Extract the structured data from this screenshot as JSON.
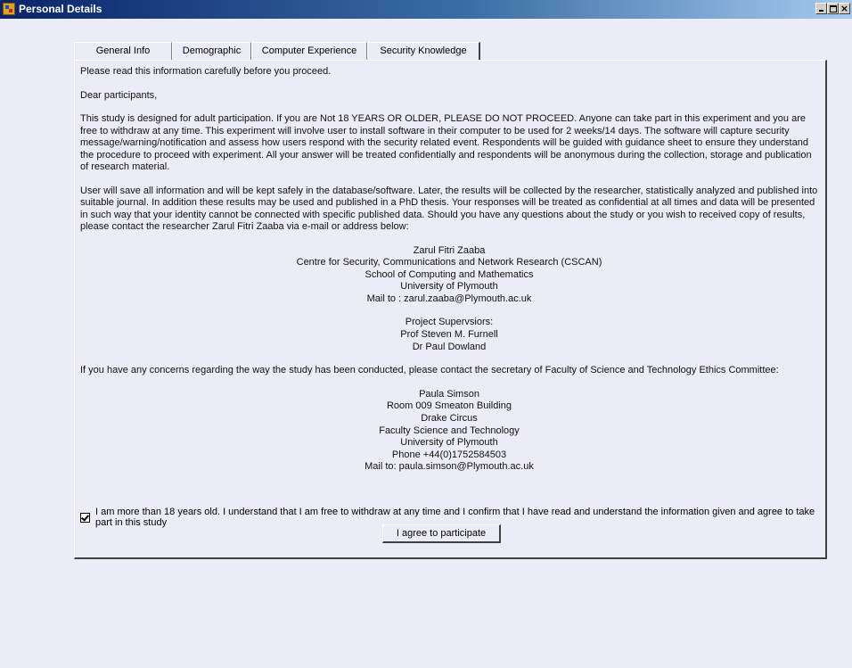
{
  "window": {
    "title": "Personal Details",
    "controls": {
      "minimize": "_",
      "maximize": "□",
      "close": "×"
    }
  },
  "tabs": [
    {
      "label": "General Info"
    },
    {
      "label": "Demographic"
    },
    {
      "label": "Computer Experience"
    },
    {
      "label": "Security Knowledge"
    }
  ],
  "content": {
    "intro": "Please read this information carefully before you proceed.",
    "greeting": "Dear participants,",
    "para1": "This study is designed for adult participation. If you are Not 18 YEARS OR OLDER, PLEASE DO NOT PROCEED. Anyone can take part in this experiment and you are free to withdraw at any time.  This experiment will involve user to install software in their computer to be used for 2 weeks/14 days.  The software will capture security message/warning/notification and assess how users respond with the security related event.  Respondents will be guided with guidance sheet to ensure they understand the procedure to proceed with experiment.  All your answer will be treated confidentially and respondents will be anonymous during the collection, storage and publication of research material.",
    "para2": "User will save all information and will be kept safely in the database/software.  Later, the results will be collected by the researcher, statistically analyzed and published into suitable journal.  In addition these results may be used and published in a PhD thesis. Your responses will be treated as confidential at all times and data will be presented in such way that your identity cannot be connected with specific published data. Should you have any questions about the study or you wish to received copy of results, please contact the researcher Zarul Fitri Zaaba via e-mail or address below:",
    "researcher": {
      "name": "Zarul Fitri Zaaba",
      "centre": "Centre for Security, Communications and Network Research (CSCAN)",
      "school": "School of Computing and Mathematics",
      "university": "University of Plymouth",
      "mail": "Mail to : zarul.zaaba@Plymouth.ac.uk"
    },
    "supervisors": {
      "heading": "Project Supervsiors:",
      "sup1": "Prof Steven M. Furnell",
      "sup2": "Dr Paul Dowland"
    },
    "concerns": "If you have any concerns regarding the way the study has been conducted, please contact the secretary of Faculty of Science and Technology Ethics Committee:",
    "secretary": {
      "name": "Paula Simson",
      "room": "Room 009 Smeaton Building",
      "area": "Drake Circus",
      "faculty": "Faculty Science and Technology",
      "university": "University of Plymouth",
      "phone": "Phone +44(0)1752584503",
      "mail": "Mail to: paula.simson@Plymouth.ac.uk"
    }
  },
  "consent": {
    "checked": true,
    "label": "I am more than 18 years old. I understand that I am free to withdraw at any time and I confirm that I have read and understand the information given and agree to take part in this study"
  },
  "agree_button": "I agree to participate"
}
